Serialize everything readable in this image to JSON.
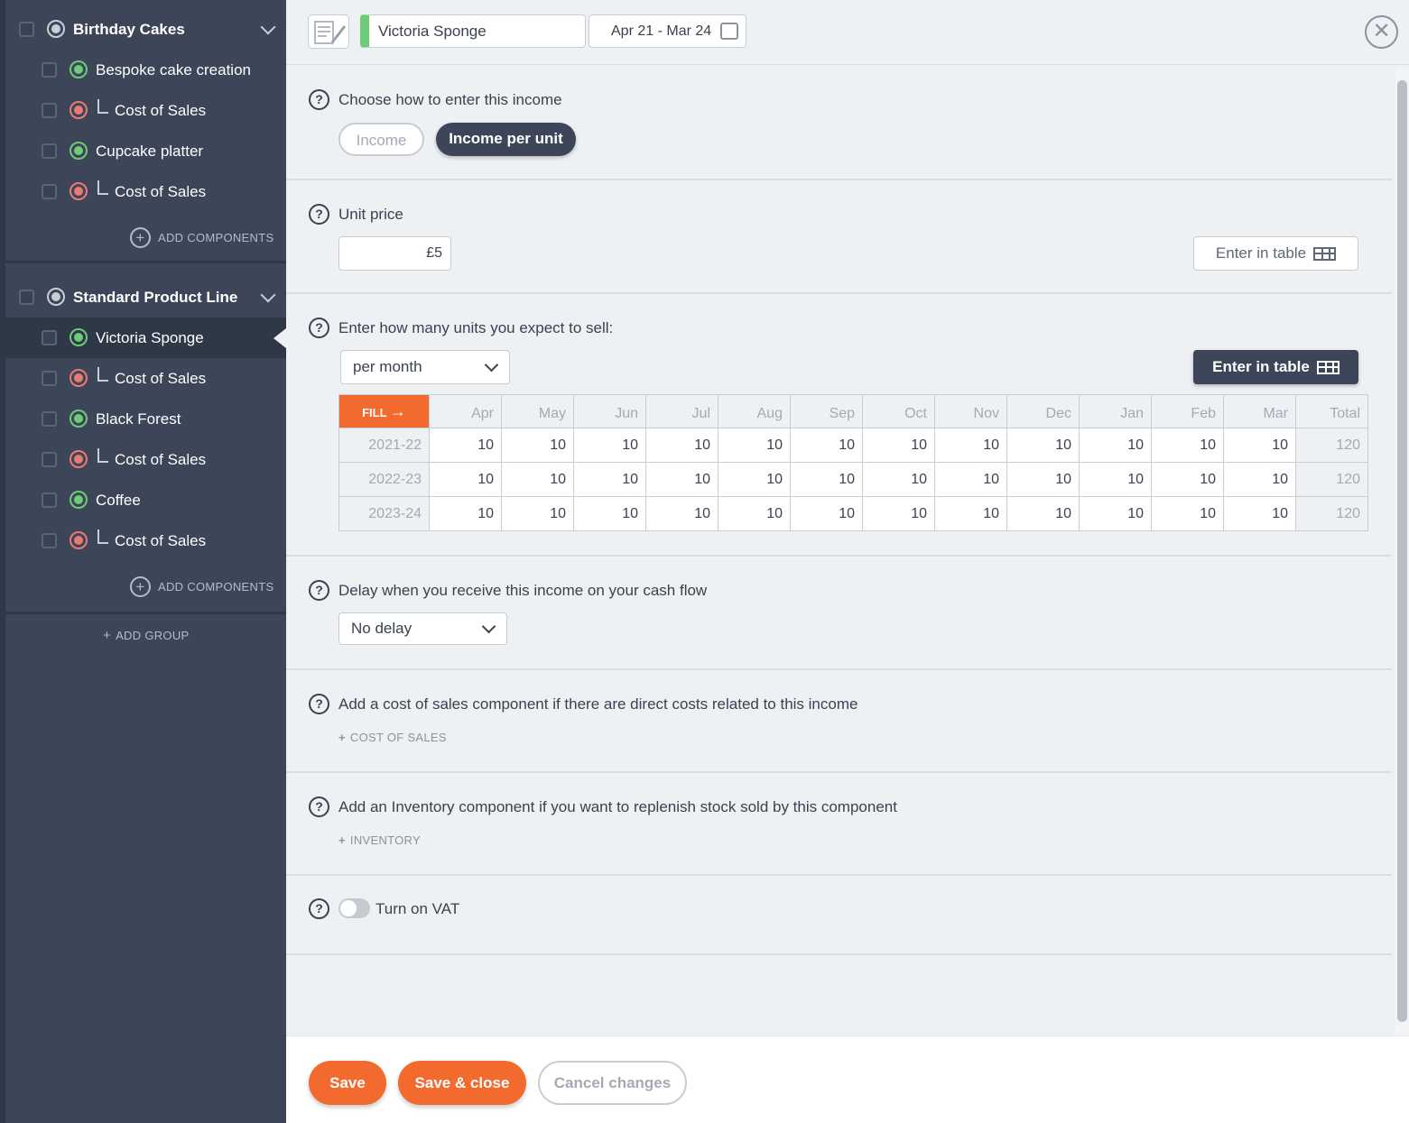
{
  "sidebar": {
    "groups": [
      {
        "name": "Birthday Cakes",
        "items": [
          {
            "label": "Bespoke cake creation",
            "type": "income"
          },
          {
            "label": "Cost of Sales",
            "type": "cost"
          },
          {
            "label": "Cupcake platter",
            "type": "income"
          },
          {
            "label": "Cost of Sales",
            "type": "cost"
          }
        ],
        "add_components_label": "ADD COMPONENTS"
      },
      {
        "name": "Standard Product Line",
        "items": [
          {
            "label": "Victoria Sponge",
            "type": "income",
            "active": true
          },
          {
            "label": "Cost of Sales",
            "type": "cost"
          },
          {
            "label": "Black Forest",
            "type": "income"
          },
          {
            "label": "Cost of Sales",
            "type": "cost"
          },
          {
            "label": "Coffee",
            "type": "income"
          },
          {
            "label": "Cost of Sales",
            "type": "cost"
          }
        ],
        "add_components_label": "ADD COMPONENTS"
      }
    ],
    "add_group_label": "ADD GROUP"
  },
  "header": {
    "name_value": "Victoria Sponge",
    "date_range": "Apr 21 - Mar 24",
    "close_symbol": "✕"
  },
  "entry_method": {
    "question": "Choose how to enter this income",
    "options": [
      "Income",
      "Income per unit"
    ],
    "selected": "Income per unit"
  },
  "unit_price": {
    "label": "Unit price",
    "value": "£5",
    "enter_in_table_label": "Enter in table"
  },
  "units": {
    "label": "Enter how many units you expect to sell:",
    "period_select": "per month",
    "enter_in_table_label": "Enter in table",
    "fill_label": "FILL",
    "columns": [
      "Apr",
      "May",
      "Jun",
      "Jul",
      "Aug",
      "Sep",
      "Oct",
      "Nov",
      "Dec",
      "Jan",
      "Feb",
      "Mar",
      "Total"
    ],
    "rows": [
      {
        "year": "2021-22",
        "values": [
          "10",
          "10",
          "10",
          "10",
          "10",
          "10",
          "10",
          "10",
          "10",
          "10",
          "10",
          "10"
        ],
        "total": "120"
      },
      {
        "year": "2022-23",
        "values": [
          "10",
          "10",
          "10",
          "10",
          "10",
          "10",
          "10",
          "10",
          "10",
          "10",
          "10",
          "10"
        ],
        "total": "120"
      },
      {
        "year": "2023-24",
        "values": [
          "10",
          "10",
          "10",
          "10",
          "10",
          "10",
          "10",
          "10",
          "10",
          "10",
          "10",
          "10"
        ],
        "total": "120"
      }
    ]
  },
  "delay": {
    "label": "Delay when you receive this income on your cash flow",
    "select_value": "No delay"
  },
  "cost_of_sales": {
    "label": "Add a cost of sales component if there are direct costs related to this income",
    "add_label": "COST OF SALES"
  },
  "inventory": {
    "label": "Add an Inventory component if you want to replenish stock sold by this component",
    "add_label": "INVENTORY"
  },
  "vat": {
    "label": "Turn on VAT",
    "enabled": false
  },
  "footer": {
    "save_label": "Save",
    "save_close_label": "Save & close",
    "cancel_label": "Cancel changes"
  },
  "colors": {
    "sidebar_bg": "#3c4658",
    "accent_orange": "#f26a2e",
    "income_green": "#6ecb77",
    "cost_red": "#ea7b74"
  }
}
